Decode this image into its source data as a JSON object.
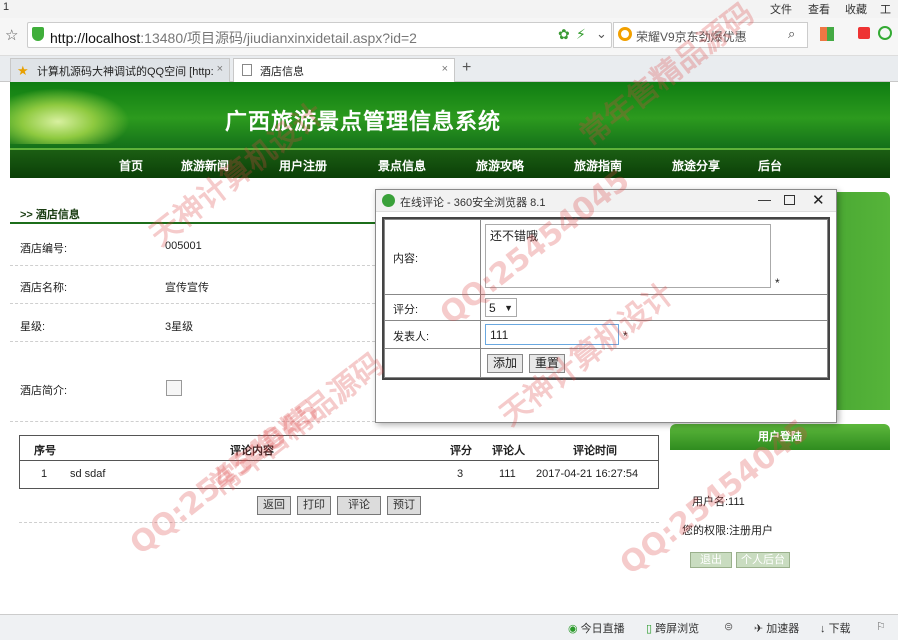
{
  "browser": {
    "menu": {
      "left_num": "1",
      "items": [
        "文件",
        "查看",
        "收藏",
        "工具"
      ]
    },
    "url_host": "http://localhost",
    "url_rest": ":13480/项目源码/jiudianxinxidetail.aspx?id=2",
    "search_text": "荣耀V9京东劲爆优惠",
    "tabs": [
      {
        "label": "计算机源码大神调试的QQ空间 [http:",
        "close": "×"
      },
      {
        "label": "酒店信息",
        "close": "×"
      }
    ],
    "new_tab": "+"
  },
  "site": {
    "title": "广西旅游景点管理信息系统",
    "nav": [
      "首页",
      "旅游新闻",
      "用户注册",
      "景点信息",
      "旅游攻略",
      "旅游指南",
      "旅途分享",
      "后台"
    ]
  },
  "hotel": {
    "section_title": ">> 酒店信息",
    "fields": [
      {
        "label": "酒店编号:",
        "value": "005001"
      },
      {
        "label": "酒店名称:",
        "value": "宣传宣传"
      },
      {
        "label": "星级:",
        "value": "3星级"
      },
      {
        "label": "酒店简介:",
        "value": ""
      }
    ]
  },
  "comments": {
    "headers": [
      "序号",
      "评论内容",
      "评分",
      "评论人",
      "评论时间"
    ],
    "rows": [
      [
        "1",
        "sd sdaf",
        "3",
        "111",
        "2017-04-21 16:27:54"
      ]
    ],
    "buttons": [
      "返回",
      "打印",
      "评论",
      "预订"
    ]
  },
  "login": {
    "title": "用户登陆",
    "username_line": "用户名:111",
    "role_line": "您的权限:注册用户",
    "buttons": [
      "退出",
      "个人后台"
    ]
  },
  "popup": {
    "title": "在线评论 - 360安全浏览器 8.1",
    "content_label": "内容:",
    "content_value": "还不错哦",
    "score_label": "评分:",
    "score_value": "5",
    "author_label": "发表人:",
    "author_value": "111",
    "required": "*",
    "add_button": "添加",
    "reset_button": "重置"
  },
  "statusbar": [
    "今日直播",
    "跨屏浏览",
    "加速器",
    "下载"
  ],
  "watermarks": [
    "QQ:25454045",
    "常年售精品源码",
    "天神计算机设计"
  ]
}
